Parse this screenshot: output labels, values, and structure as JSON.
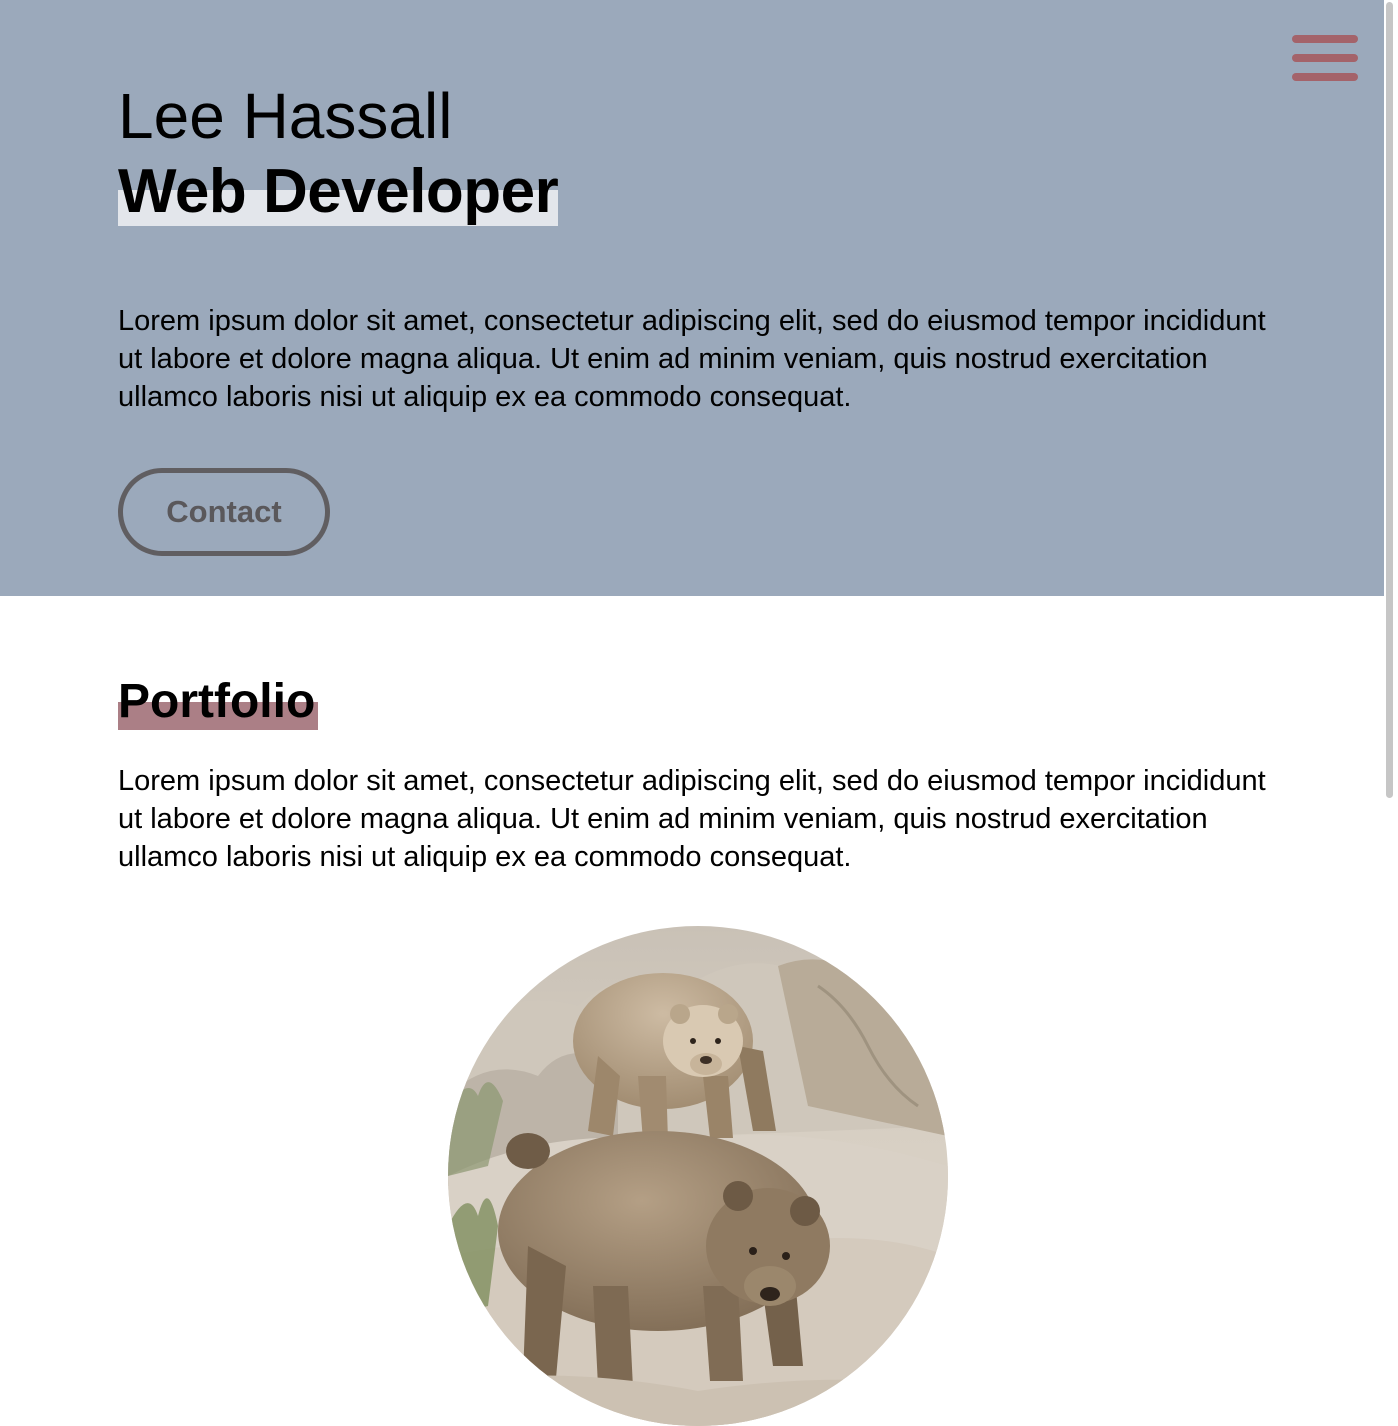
{
  "header": {
    "name": "Lee Hassall",
    "role": "Web Developer",
    "intro": "Lorem ipsum dolor sit amet, consectetur adipiscing elit, sed do eiusmod tempor incididunt ut labore et dolore magna aliqua. Ut enim ad minim veniam, quis nostrud exercitation ullamco laboris nisi ut aliquip ex ea commodo consequat.",
    "contact_label": "Contact",
    "menu_icon": "hamburger-menu-icon"
  },
  "portfolio": {
    "title": "Portfolio",
    "intro": "Lorem ipsum dolor sit amet, consectetur adipiscing elit, sed do eiusmod tempor incididunt ut labore et dolore magna aliqua. Ut enim ad minim veniam, quis nostrud exercitation ullamco laboris nisi ut aliquip ex ea commodo consequat.",
    "image": "two-bears-on-rocks"
  },
  "colors": {
    "hero_background": "#9ba9bb",
    "menu_icon": "#a4636a",
    "role_highlight": "#e3e6eb",
    "portfolio_highlight": "#ab7f86",
    "contact_border": "#605e61"
  }
}
